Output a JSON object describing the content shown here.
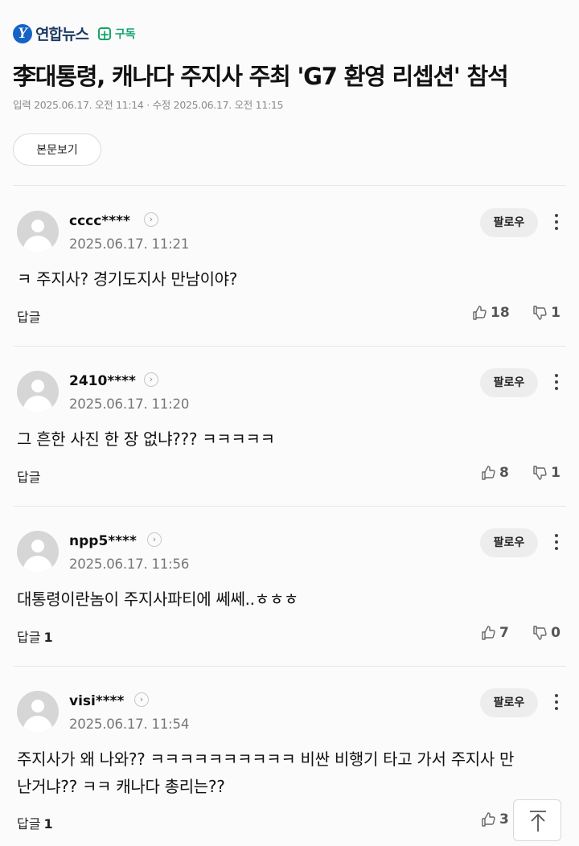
{
  "header": {
    "logo_mark": "Y",
    "brand": "연합뉴스",
    "subscribe_label": "구독",
    "headline": "李대통령, 캐나다 주지사 주최 'G7 환영 리셉션' 참석",
    "meta": "입력 2025.06.17. 오전 11:14 · 수정 2025.06.17. 오전 11:15",
    "view_body_label": "본문보기"
  },
  "comments": [
    {
      "user": "cccc****",
      "time": "2025.06.17. 11:21",
      "text": "ㅋ 주지사? 경기도지사 만남이야?",
      "reply_label": "답글",
      "reply_count": "",
      "likes": "18",
      "dislikes": "1",
      "follow_label": "팔로우"
    },
    {
      "user": "2410****",
      "time": "2025.06.17. 11:20",
      "text": "그 흔한 사진 한 장 없냐??? ㅋㅋㅋㅋㅋ",
      "reply_label": "답글",
      "reply_count": "",
      "likes": "8",
      "dislikes": "1",
      "follow_label": "팔로우"
    },
    {
      "user": "npp5****",
      "time": "2025.06.17. 11:56",
      "text": "대통령이란놈이 주지사파티에 쎄쎄..ㅎㅎㅎ",
      "reply_label": "답글",
      "reply_count": "1",
      "likes": "7",
      "dislikes": "0",
      "follow_label": "팔로우"
    },
    {
      "user": "visi****",
      "time": "2025.06.17. 11:54",
      "text": "주지사가 왜 나와?? ㅋㅋㅋㅋㅋㅋㅋㅋㅋㅋ 비싼 비행기 타고 가서 주지사 만난거냐?? ㅋㅋ 캐나다 총리는??",
      "reply_label": "답글",
      "reply_count": "1",
      "likes": "3",
      "dislikes": "",
      "follow_label": "팔로우"
    }
  ],
  "icons": {
    "more": "more-vertical-icon",
    "like": "thumbs-up-icon",
    "dislike": "thumbs-down-icon",
    "scroll_top": "arrow-up-icon",
    "avatar": "default-avatar-icon"
  },
  "colors": {
    "brand_blue": "#1463c6",
    "subscribe_green": "#13a46a"
  }
}
